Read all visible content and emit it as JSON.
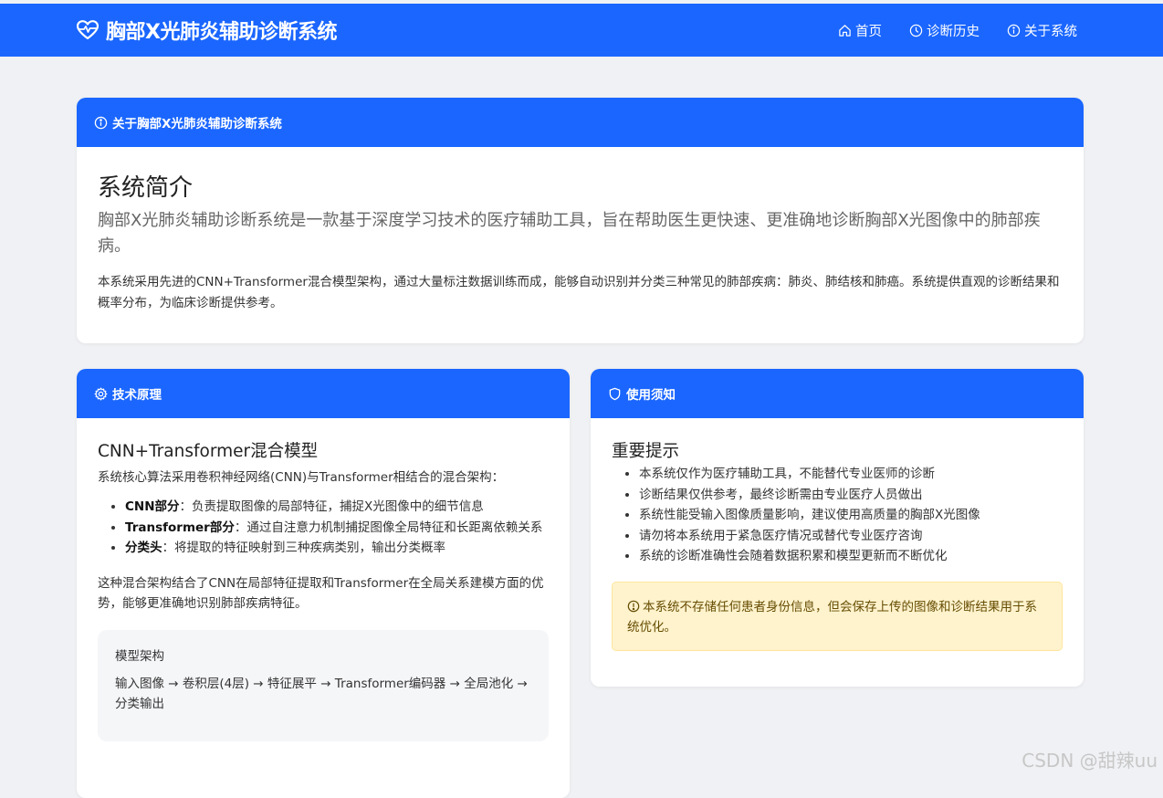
{
  "header": {
    "brand": "胸部X光肺炎辅助诊断系统",
    "nav": [
      {
        "label": "首页",
        "icon": "home-icon"
      },
      {
        "label": "诊断历史",
        "icon": "clock-icon"
      },
      {
        "label": "关于系统",
        "icon": "info-icon"
      }
    ]
  },
  "about": {
    "header": "关于胸部X光肺炎辅助诊断系统",
    "title": "系统简介",
    "lead": "胸部X光肺炎辅助诊断系统是一款基于深度学习技术的医疗辅助工具，旨在帮助医生更快速、更准确地诊断胸部X光图像中的肺部疾病。",
    "paragraph": "本系统采用先进的CNN+Transformer混合模型架构，通过大量标注数据训练而成，能够自动识别并分类三种常见的肺部疾病：肺炎、肺结核和肺癌。系统提供直观的诊断结果和概率分布，为临床诊断提供参考。"
  },
  "tech": {
    "header": "技术原理",
    "title": "CNN+Transformer混合模型",
    "intro": "系统核心算法采用卷积神经网络(CNN)与Transformer相结合的混合架构：",
    "items": [
      {
        "term": "CNN部分",
        "desc": "：负责提取图像的局部特征，捕捉X光图像中的细节信息"
      },
      {
        "term": "Transformer部分",
        "desc": "：通过自注意力机制捕捉图像全局特征和长距离依赖关系"
      },
      {
        "term": "分类头",
        "desc": "：将提取的特征映射到三种疾病类别，输出分类概率"
      }
    ],
    "summary": "这种混合架构结合了CNN在局部特征提取和Transformer在全局关系建模方面的优势，能够更准确地识别肺部疾病特征。",
    "arch_title": "模型架构",
    "arch_text": "输入图像 → 卷积层(4层) → 特征展平 → Transformer编码器 → 全局池化 → 分类输出"
  },
  "notice": {
    "header": "使用须知",
    "title": "重要提示",
    "items": [
      "本系统仅作为医疗辅助工具，不能替代专业医师的诊断",
      "诊断结果仅供参考，最终诊断需由专业医疗人员做出",
      "系统性能受输入图像质量影响，建议使用高质量的胸部X光图像",
      "请勿将本系统用于紧急医疗情况或替代专业医疗咨询",
      "系统的诊断准确性会随着数据积累和模型更新而不断优化"
    ],
    "alert": "本系统不存储任何患者身份信息，但会保存上传的图像和诊断结果用于系统优化。"
  },
  "watermark": "CSDN @甜辣uu",
  "colors": {
    "primary": "#1a66ff",
    "background": "#f0f1f4",
    "alert_bg": "#fff3cd",
    "alert_text": "#664d03"
  }
}
